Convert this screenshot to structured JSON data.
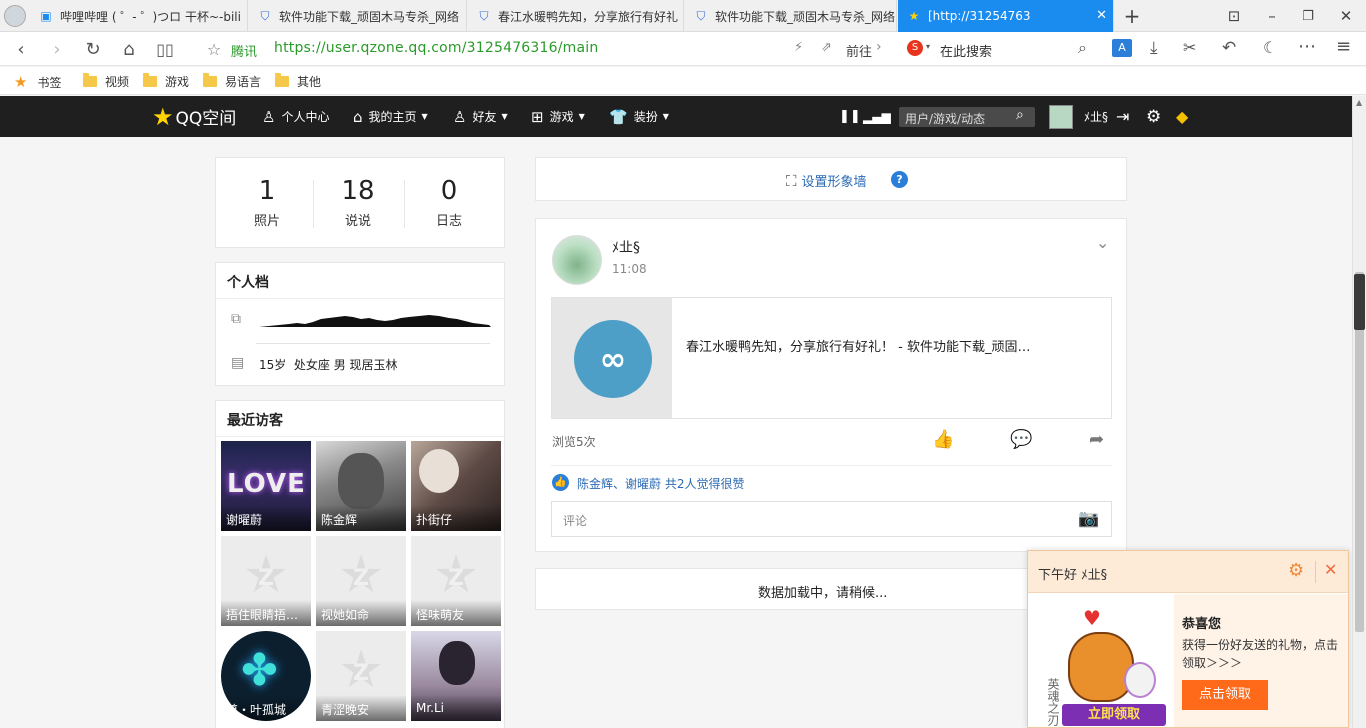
{
  "browser": {
    "tabs": [
      {
        "label": "哔哩哔哩 ( ゜- ゜)つロ 干杯~-bili",
        "icon": "bilibili-icon"
      },
      {
        "label": "软件功能下载_顽固木马专杀_网络",
        "icon": "shield-icon"
      },
      {
        "label": "春江水暖鸭先知，分享旅行有好礼",
        "icon": "shield-icon"
      },
      {
        "label": "软件功能下载_顽固木马专杀_网络",
        "icon": "shield-icon"
      },
      {
        "label": "[http://31254763",
        "icon": "star-icon",
        "active": true
      }
    ],
    "site_name": "腾讯",
    "url": "https://user.qzone.qq.com/3125476316/main",
    "go_label": "前往",
    "search_placeholder": "在此搜索",
    "bookmarks": {
      "star_label": "书签",
      "folders": [
        "视频",
        "游戏",
        "易语言",
        "其他"
      ]
    }
  },
  "qzone": {
    "logo": "QQ空间",
    "nav": {
      "personal_center": "个人中心",
      "my_home": "我的主页",
      "friends": "好友",
      "games": "游戏",
      "decorate": "装扮"
    },
    "search_placeholder": "用户/游戏/动态",
    "username": "ﾒ㐀§"
  },
  "stats": [
    {
      "value": "1",
      "label": "照片"
    },
    {
      "value": "18",
      "label": "说说"
    },
    {
      "value": "0",
      "label": "日志"
    }
  ],
  "profile": {
    "title": "个人档",
    "info": "15岁  处女座 男 现居玉林"
  },
  "visitors": {
    "title": "最近访客",
    "items": [
      {
        "name": "谢曜蔚",
        "type": "love"
      },
      {
        "name": "陈金辉",
        "type": "photo-dark"
      },
      {
        "name": "扑街仔",
        "type": "photo-cat"
      },
      {
        "name": "捂住眼睛捂…",
        "type": "placeholder"
      },
      {
        "name": "视她如命",
        "type": "placeholder"
      },
      {
        "name": "怪味萌友",
        "type": "placeholder"
      },
      {
        "name": "尊・叶孤城",
        "type": "clover"
      },
      {
        "name": "青涩晚安",
        "type": "placeholder"
      },
      {
        "name": "Mr.Li",
        "type": "photo-light"
      }
    ]
  },
  "image_wall": {
    "label": "设置形象墙",
    "help": "?"
  },
  "feed": {
    "author": "ﾒ㐀§",
    "time": "11:08",
    "share_title": "春江水暖鸭先知，分享旅行有好礼！ - 软件功能下载_顽固…",
    "views": "浏览5次",
    "likes_text": "陈金辉、谢曜蔚 共2人觉得很赞",
    "comment_placeholder": "评论"
  },
  "loading": "数据加载中，请稍候...",
  "popup": {
    "greeting": "下午好 ﾒ㐀§",
    "title": "恭喜您",
    "message": "获得一份好友送的礼物，点击领取＞＞＞",
    "button": "点击领取",
    "badge": "立即领取",
    "side_text": "英魂之刃"
  },
  "colors": {
    "accent": "#1a8cf0",
    "qzone_header": "#1f1f1f",
    "link": "#2b6bb5",
    "popup_bg": "#fff3e8",
    "popup_button": "#ff6a1a"
  }
}
